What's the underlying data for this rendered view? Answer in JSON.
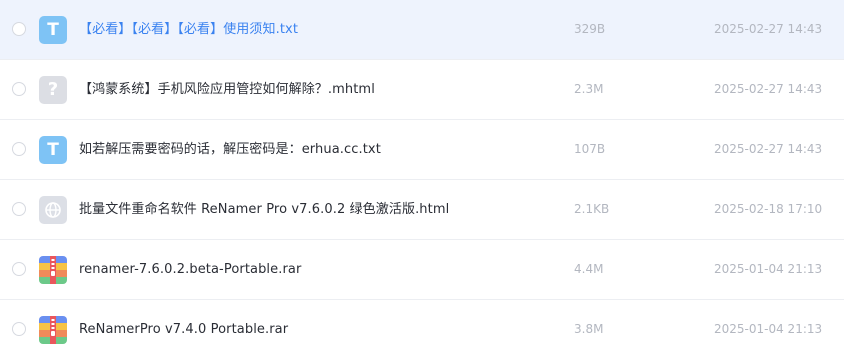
{
  "files": [
    {
      "name": "【必看】【必看】【必看】使用须知.txt",
      "size": "329B",
      "date": "2025-02-27 14:43",
      "icon": "txt-file-icon"
    },
    {
      "name": "【鸿蒙系统】手机风险应用管控如何解除？.mhtml",
      "size": "2.3M",
      "date": "2025-02-27 14:43",
      "icon": "unknown-file-icon"
    },
    {
      "name": "如若解压需要密码的话，解压密码是：erhua.cc.txt",
      "size": "107B",
      "date": "2025-02-27 14:43",
      "icon": "txt-file-icon"
    },
    {
      "name": "批量文件重命名软件 ReNamer Pro v7.6.0.2 绿色激活版.html",
      "size": "2.1KB",
      "date": "2025-02-18 17:10",
      "icon": "web-file-icon"
    },
    {
      "name": "renamer-7.6.0.2.beta-Portable.rar",
      "size": "4.4M",
      "date": "2025-01-04 21:13",
      "icon": "archive-file-icon"
    },
    {
      "name": "ReNamerPro v7.4.0 Portable.rar",
      "size": "3.8M",
      "date": "2025-01-04 21:13",
      "icon": "archive-file-icon"
    }
  ],
  "icon_glyphs": {
    "txt": "T",
    "unknown": "?"
  },
  "colors": {
    "hover_row": "#eef3fd",
    "hover_text": "#3a82f0",
    "txt_icon": "#7ec3f5",
    "meta_text": "#b3b7c0"
  }
}
